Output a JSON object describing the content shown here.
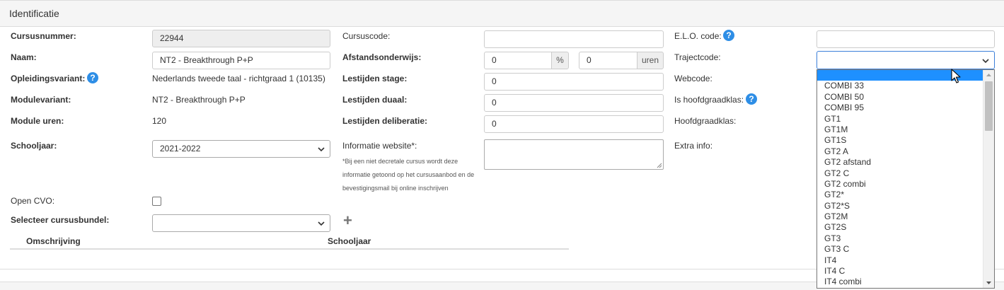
{
  "panel": {
    "title": "Identificatie"
  },
  "col1": {
    "cursusnummer_label": "Cursusnummer:",
    "cursusnummer_value": "22944",
    "naam_label": "Naam:",
    "naam_value": "NT2 - Breakthrough P+P",
    "opleidingsvariant_label": "Opleidingsvariant:",
    "opleidingsvariant_value": "Nederlands tweede taal - richtgraad 1 (10135)",
    "modulevariant_label": "Modulevariant:",
    "modulevariant_value": "NT2 - Breakthrough P+P",
    "module_uren_label": "Module uren:",
    "module_uren_value": "120",
    "schooljaar_label": "Schooljaar:",
    "schooljaar_value": "2021-2022",
    "open_cvo_label": "Open CVO:",
    "open_cvo_checked": false,
    "cursusbundel_label": "Selecteer cursusbundel:",
    "cursusbundel_value": ""
  },
  "col2": {
    "cursuscode_label": "Cursuscode:",
    "cursuscode_value": "",
    "afstandsonderwijs_label": "Afstandsonderwijs:",
    "afstand_percent_value": "0",
    "afstand_percent_addon": "%",
    "afstand_uren_value": "0",
    "afstand_uren_addon": "uren",
    "lestijden_stage_label": "Lestijden stage:",
    "lestijden_stage_value": "0",
    "lestijden_duaal_label": "Lestijden duaal:",
    "lestijden_duaal_value": "0",
    "lestijden_deliberatie_label": "Lestijden deliberatie:",
    "lestijden_deliberatie_value": "0",
    "informatie_website_label": "Informatie website*:",
    "informatie_website_note": "*Bij een niet decretale cursus wordt deze informatie getoond op het cursusaanbod en de bevestigingsmail bij online inschrijven"
  },
  "col3": {
    "elo_code_label": "E.L.O. code:",
    "elo_code_value": "",
    "trajectcode_label": "Trajectcode:",
    "trajectcode_value": "",
    "webcode_label": "Webcode:",
    "is_hoofdgraadklas_label": "Is hoofdgraadklas:",
    "hoofdgraadklas_label": "Hoofdgraadklas:",
    "extra_info_label": "Extra info:"
  },
  "table": {
    "headers": [
      "Omschrijving",
      "Schooljaar"
    ]
  },
  "trajectcode_dropdown": {
    "options": [
      "",
      "COMBI 33",
      "COMBI 50",
      "COMBI 95",
      "GT1",
      "GT1M",
      "GT1S",
      "GT2 A",
      "GT2 afstand",
      "GT2 C",
      "GT2 combi",
      "GT2*",
      "GT2*S",
      "GT2M",
      "GT2S",
      "GT3",
      "GT3 C",
      "IT4",
      "IT4 C",
      "IT4 combi"
    ],
    "highlighted_index": 0
  },
  "help_icon_glyph": "?",
  "plus_glyph": "+",
  "colors": {
    "accent": "#2e8ee6",
    "highlight": "#1e90ff",
    "header_bg": "#f5f5f5",
    "readonly_bg": "#eeeeee"
  }
}
